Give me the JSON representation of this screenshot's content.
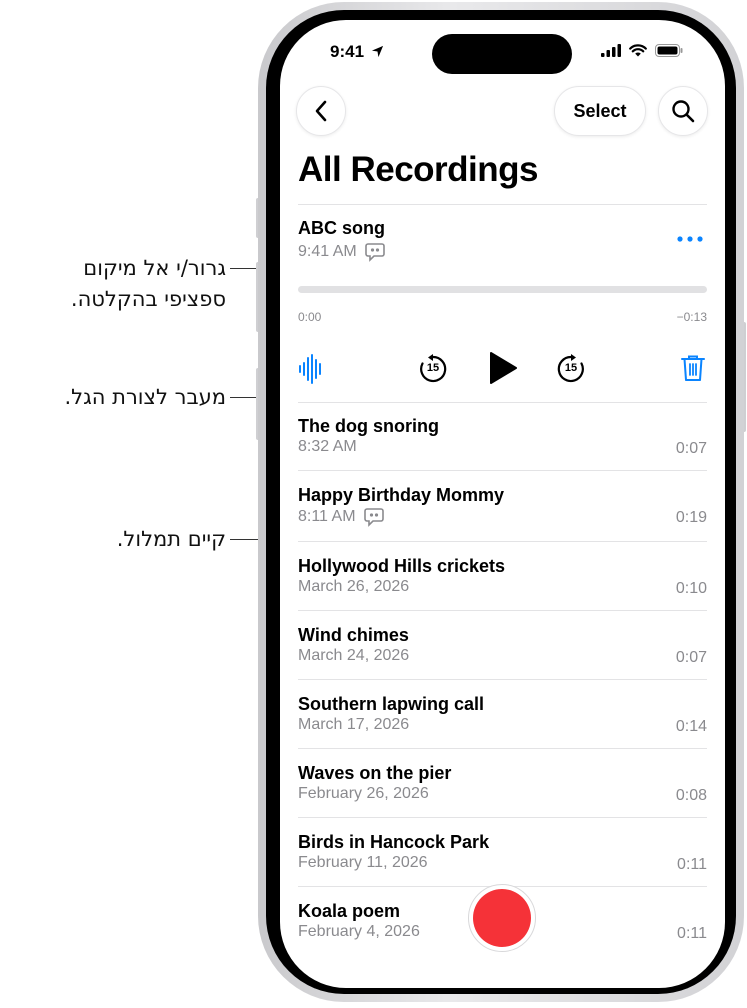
{
  "callouts": {
    "scrub_line1": "גרור/י אל מיקום",
    "scrub_line2": "ספציפי בהקלטה.",
    "waveform": "מעבר לצורת הגל.",
    "transcript": "קיים תמלול."
  },
  "status_bar": {
    "time": "9:41"
  },
  "toolbar": {
    "select_label": "Select"
  },
  "page": {
    "title": "All Recordings"
  },
  "selected_recording": {
    "name": "ABC song",
    "time": "9:41 AM",
    "elapsed": "0:00",
    "remaining": "−0:13",
    "progress": 0,
    "skip_back_seconds": "15",
    "skip_forward_seconds": "15"
  },
  "recordings": [
    {
      "name": "The dog snoring",
      "date": "8:32 AM",
      "duration": "0:07",
      "transcript": false
    },
    {
      "name": "Happy Birthday Mommy",
      "date": "8:11 AM",
      "duration": "0:19",
      "transcript": true
    },
    {
      "name": "Hollywood Hills crickets",
      "date": "March 26, 2026",
      "duration": "0:10",
      "transcript": false
    },
    {
      "name": "Wind chimes",
      "date": "March 24, 2026",
      "duration": "0:07",
      "transcript": false
    },
    {
      "name": "Southern lapwing call",
      "date": "March 17, 2026",
      "duration": "0:14",
      "transcript": false
    },
    {
      "name": "Waves on the pier",
      "date": "February 26, 2026",
      "duration": "0:08",
      "transcript": false
    },
    {
      "name": "Birds in Hancock Park",
      "date": "February 11, 2026",
      "duration": "0:11",
      "transcript": false
    },
    {
      "name": "Koala poem",
      "date": "February 4, 2026",
      "duration": "0:11",
      "transcript": false
    }
  ],
  "colors": {
    "accent": "#0a84ff",
    "record": "#f53238",
    "secondary_text": "#8a8a8e"
  },
  "icons": {
    "back": "chevron-left-icon",
    "search": "magnifier-icon",
    "more": "ellipsis-icon",
    "waveform": "waveform-icon",
    "skip_back": "skip-back-15-icon",
    "play": "play-icon",
    "skip_forward": "skip-forward-15-icon",
    "delete": "trash-icon",
    "transcript": "quote-bubble-icon"
  }
}
